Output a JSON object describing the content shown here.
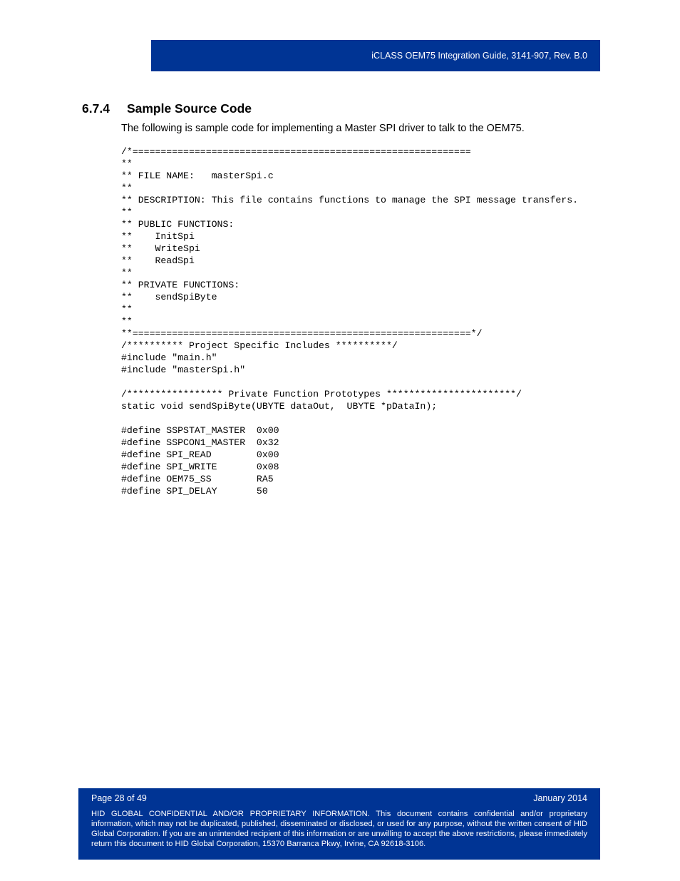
{
  "header": {
    "doc_title": "iCLASS OEM75 Integration Guide, 3141-907, Rev. B.0"
  },
  "section": {
    "number": "6.7.4",
    "title": "Sample Source Code",
    "intro": "The following is sample code for implementing a Master SPI driver to talk to the OEM75."
  },
  "code": "/*============================================================\n**\n** FILE NAME:   masterSpi.c\n**\n** DESCRIPTION: This file contains functions to manage the SPI message transfers.\n**\n** PUBLIC FUNCTIONS:\n**    InitSpi\n**    WriteSpi\n**    ReadSpi\n**\n** PRIVATE FUNCTIONS:\n**    sendSpiByte\n**\n**\n**============================================================*/\n/********** Project Specific Includes **********/\n#include \"main.h\"\n#include \"masterSpi.h\"\n\n/***************** Private Function Prototypes ***********************/\nstatic void sendSpiByte(UBYTE dataOut,  UBYTE *pDataIn);\n\n#define SSPSTAT_MASTER  0x00\n#define SSPCON1_MASTER  0x32\n#define SPI_READ        0x00\n#define SPI_WRITE       0x08\n#define OEM75_SS        RA5\n#define SPI_DELAY       50",
  "footer": {
    "page": "Page 28 of 49",
    "date": "January 2014",
    "confidential": "HID GLOBAL CONFIDENTIAL AND/OR PROPRIETARY INFORMATION. This document contains confidential and/or proprietary information, which may not be duplicated, published, disseminated or disclosed, or used for any purpose, without the written consent of HID Global Corporation. If you are an unintended recipient of this information or are unwilling to accept the above restrictions, please immediately return this document to HID Global Corporation, 15370 Barranca Pkwy, Irvine, CA 92618-3106."
  }
}
